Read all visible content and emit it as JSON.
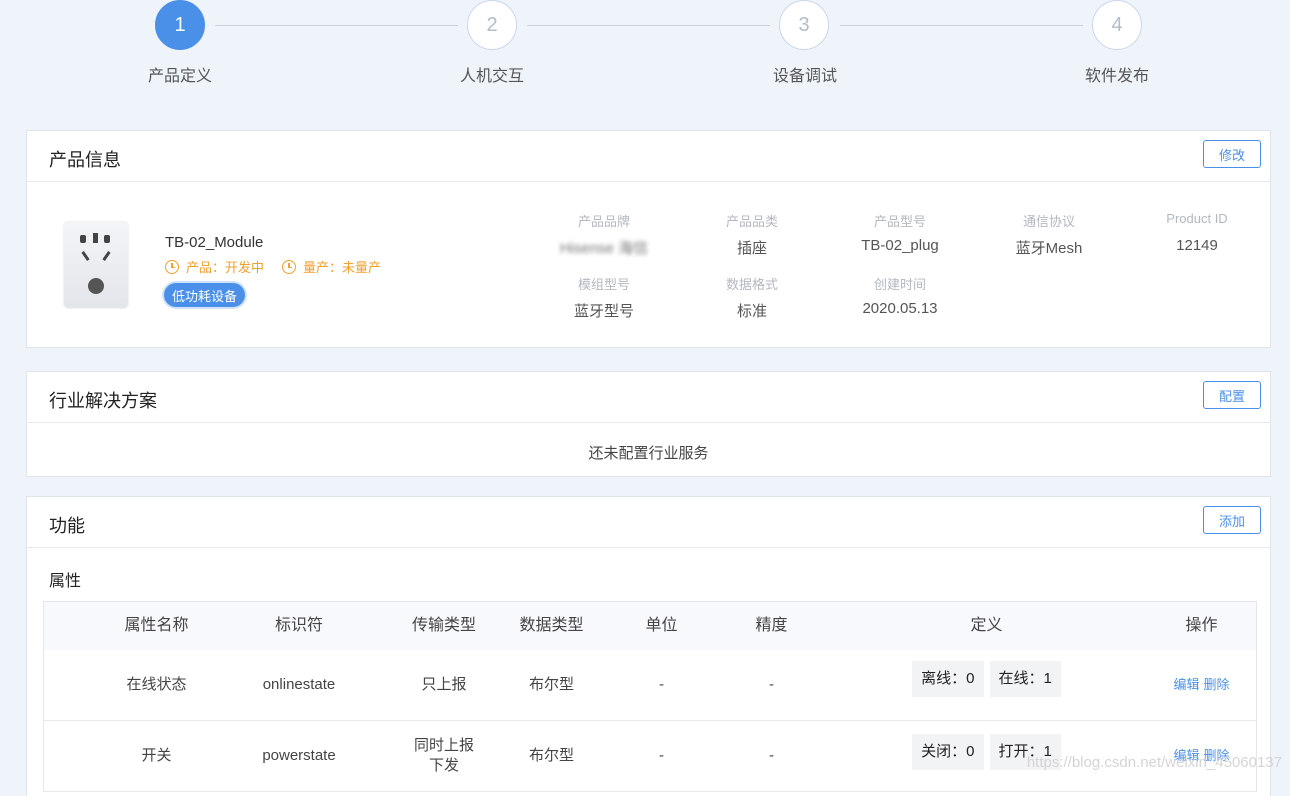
{
  "steps": [
    {
      "num": "1",
      "label": "产品定义",
      "active": true
    },
    {
      "num": "2",
      "label": "人机交互",
      "active": false
    },
    {
      "num": "3",
      "label": "设备调试",
      "active": false
    },
    {
      "num": "4",
      "label": "软件发布",
      "active": false
    }
  ],
  "product_info": {
    "title": "产品信息",
    "edit_button": "修改",
    "name": "TB-02_Module",
    "product_status": "产品：开发中",
    "mass_status": "量产：未量产",
    "badge": "低功耗设备",
    "fields": [
      {
        "label": "产品品牌",
        "value": "Hisense 海信"
      },
      {
        "label": "产品品类",
        "value": "插座"
      },
      {
        "label": "产品型号",
        "value": "TB-02_plug"
      },
      {
        "label": "通信协议",
        "value": "蓝牙Mesh"
      },
      {
        "label": "Product ID",
        "value": "12149"
      },
      {
        "label": "模组型号",
        "value": "蓝牙型号"
      },
      {
        "label": "数据格式",
        "value": "标准"
      },
      {
        "label": "创建时间",
        "value": "2020.05.13"
      }
    ]
  },
  "industry": {
    "title": "行业解决方案",
    "config_button": "配置",
    "empty_text": "还未配置行业服务"
  },
  "functions": {
    "title": "功能",
    "add_button": "添加",
    "section": "属性",
    "columns": [
      "属性名称",
      "标识符",
      "传输类型",
      "数据类型",
      "单位",
      "精度",
      "定义",
      "操作"
    ],
    "rows": [
      {
        "name": "在线状态",
        "id": "onlinestate",
        "transfer": "只上报",
        "type": "布尔型",
        "unit": "-",
        "precision": "-",
        "def": [
          "离线：0",
          "在线：1"
        ],
        "edit": "编辑",
        "delete": "删除"
      },
      {
        "name": "开关",
        "id": "powerstate",
        "transfer": "同时上报\n下发",
        "type": "布尔型",
        "unit": "-",
        "precision": "-",
        "def": [
          "关闭：0",
          "打开：1"
        ],
        "edit": "编辑",
        "delete": "删除"
      }
    ]
  },
  "watermark": "https://blog.csdn.net/weixin_45060137"
}
